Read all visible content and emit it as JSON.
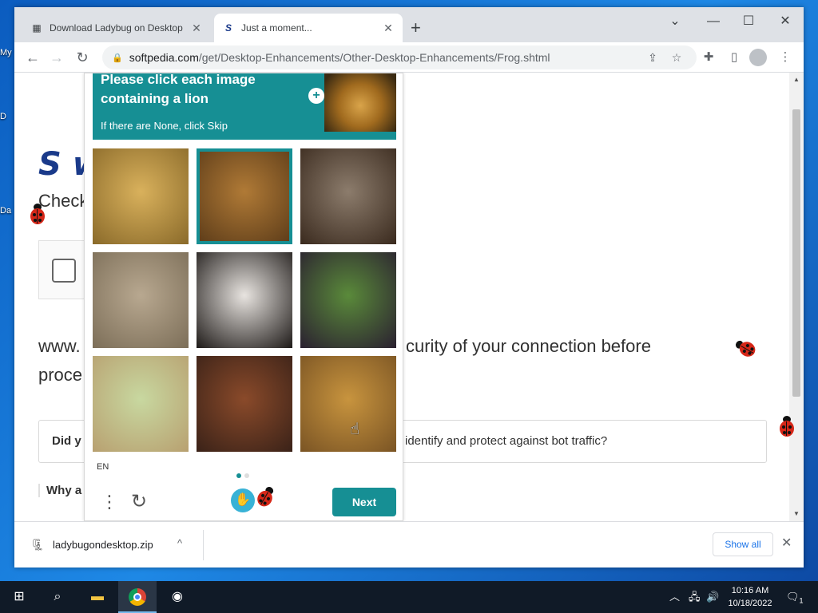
{
  "desktop": {
    "labels": [
      "My",
      "D",
      "Da"
    ]
  },
  "browser": {
    "tabs": [
      {
        "title": "Download Ladybug on Desktop",
        "active": false
      },
      {
        "title": "Just a moment...",
        "active": true
      }
    ],
    "new_tab": "+",
    "window_controls": {
      "dropdown": "⌄",
      "minimize": "—",
      "maximize": "☐",
      "close": "✕"
    },
    "nav": {
      "back": "←",
      "forward": "→",
      "reload": "↻"
    },
    "url_host": "softpedia.com",
    "url_path": "/get/Desktop-Enhancements/Other-Desktop-Enhancements/Frog.shtml",
    "toolbar_icons": [
      "share-icon",
      "star-icon",
      "extensions-icon",
      "sidebar-icon",
      "profile-icon",
      "menu-icon"
    ]
  },
  "page": {
    "logo_letter": "S",
    "logo_rest": "w",
    "check_text": "Check",
    "line1_left": "www.",
    "line1_right": "curity of your connection before",
    "line2": "proce",
    "did_left": "Did y",
    "did_right": "identify and protect against bot traffic?",
    "why": "Why a"
  },
  "captcha": {
    "prompt": "Please click each image containing a lion",
    "sub": "If there are None, click Skip",
    "images": [
      {
        "label": "lion-cub",
        "colors": [
          "#d9b15c",
          "#8a6a2a"
        ],
        "selected": false
      },
      {
        "label": "lion",
        "colors": [
          "#b07a36",
          "#5a3a18"
        ],
        "selected": true
      },
      {
        "label": "horse-pinto",
        "colors": [
          "#8c7c6c",
          "#3a2a1e"
        ],
        "selected": false
      },
      {
        "label": "lioness",
        "colors": [
          "#b8a890",
          "#7c6e58"
        ],
        "selected": false
      },
      {
        "label": "dog",
        "colors": [
          "#e8e4e0",
          "#1e1a18"
        ],
        "selected": false
      },
      {
        "label": "horse-dark",
        "colors": [
          "#5a8a3a",
          "#2a2030"
        ],
        "selected": false
      },
      {
        "label": "pony",
        "colors": [
          "#c8d8a0",
          "#b8a070"
        ],
        "selected": false
      },
      {
        "label": "chihuahua",
        "colors": [
          "#8a4a2a",
          "#3a2218"
        ],
        "selected": false
      },
      {
        "label": "lion-face",
        "colors": [
          "#c8943e",
          "#7a5424"
        ],
        "selected": false
      }
    ],
    "language": "EN",
    "next_label": "Next",
    "menu_glyph": "⋮",
    "refresh_glyph": "↻"
  },
  "downloads": {
    "file": "ladybugondesktop.zip",
    "chevron": "^",
    "show_all": "Show all",
    "close": "✕"
  },
  "taskbar": {
    "time": "10:16 AM",
    "date": "10/18/2022",
    "notifications": "1"
  }
}
